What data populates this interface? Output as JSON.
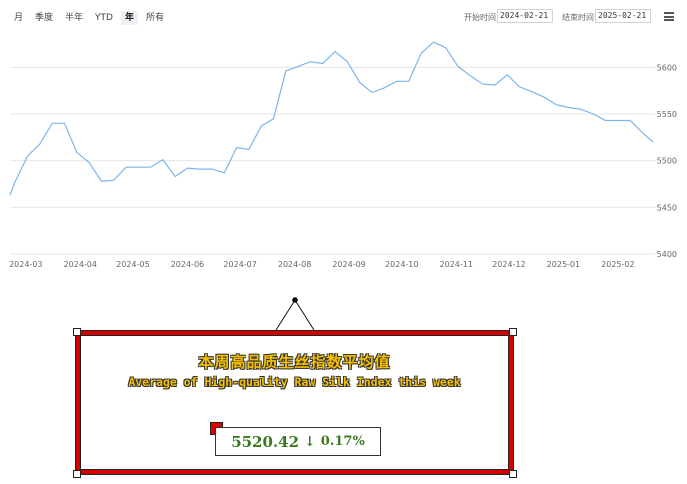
{
  "toolbar": {
    "tabs": [
      "月",
      "季度",
      "半年",
      "YTD",
      "年",
      "所有"
    ],
    "active_tab": "年",
    "start_label": "开始时间",
    "start_value": "2024-02-21",
    "end_label": "结束时间",
    "end_value": "2025-02-21"
  },
  "chart_data": {
    "type": "line",
    "x_ticks": [
      "2024-03",
      "2024-04",
      "2024-05",
      "2024-06",
      "2024-07",
      "2024-08",
      "2024-09",
      "2024-10",
      "2024-11",
      "2024-12",
      "2025-01",
      "2025-02"
    ],
    "y_ticks": [
      5400,
      5450,
      5500,
      5550,
      5600
    ],
    "ylim": [
      5400,
      5640
    ],
    "grid": true,
    "line_color": "#7cb5ec",
    "series": [
      {
        "values": [
          [
            "2024-02-21",
            5463
          ],
          [
            "2024-02-24",
            5478
          ],
          [
            "2024-03-02",
            5505
          ],
          [
            "2024-03-09",
            5518
          ],
          [
            "2024-03-16",
            5540
          ],
          [
            "2024-03-23",
            5540
          ],
          [
            "2024-03-30",
            5509
          ],
          [
            "2024-04-06",
            5498
          ],
          [
            "2024-04-13",
            5478
          ],
          [
            "2024-04-20",
            5479
          ],
          [
            "2024-04-27",
            5493
          ],
          [
            "2024-05-04",
            5493
          ],
          [
            "2024-05-11",
            5493
          ],
          [
            "2024-05-18",
            5501
          ],
          [
            "2024-05-25",
            5483
          ],
          [
            "2024-06-01",
            5492
          ],
          [
            "2024-06-08",
            5491
          ],
          [
            "2024-06-15",
            5491
          ],
          [
            "2024-06-22",
            5487
          ],
          [
            "2024-06-29",
            5514
          ],
          [
            "2024-07-06",
            5512
          ],
          [
            "2024-07-13",
            5537
          ],
          [
            "2024-07-20",
            5545
          ],
          [
            "2024-07-27",
            5596
          ],
          [
            "2024-08-03",
            5601
          ],
          [
            "2024-08-10",
            5606
          ],
          [
            "2024-08-17",
            5604
          ],
          [
            "2024-08-24",
            5617
          ],
          [
            "2024-08-31",
            5606
          ],
          [
            "2024-09-07",
            5584
          ],
          [
            "2024-09-14",
            5573
          ],
          [
            "2024-09-21",
            5578
          ],
          [
            "2024-09-28",
            5585
          ],
          [
            "2024-10-05",
            5585
          ],
          [
            "2024-10-12",
            5615
          ],
          [
            "2024-10-19",
            5627
          ],
          [
            "2024-10-26",
            5621
          ],
          [
            "2024-11-02",
            5601
          ],
          [
            "2024-11-09",
            5591
          ],
          [
            "2024-11-16",
            5582
          ],
          [
            "2024-11-23",
            5581
          ],
          [
            "2024-11-30",
            5592
          ],
          [
            "2024-12-07",
            5579
          ],
          [
            "2024-12-14",
            5574
          ],
          [
            "2024-12-21",
            5568
          ],
          [
            "2024-12-28",
            5560
          ],
          [
            "2025-01-04",
            5557
          ],
          [
            "2025-01-11",
            5555
          ],
          [
            "2025-01-18",
            5550
          ],
          [
            "2025-01-25",
            5543
          ],
          [
            "2025-02-01",
            5543
          ],
          [
            "2025-02-08",
            5543
          ],
          [
            "2025-02-15",
            5530
          ],
          [
            "2025-02-21",
            5520
          ]
        ]
      }
    ]
  },
  "panel": {
    "title_cn": "本周高品质生丝指数平均值",
    "title_en": "Average of High-quality Raw Silk Index this week",
    "value": "5520.42",
    "arrow": "↓",
    "change": "0.17%",
    "accent_color": "#d40000",
    "value_color": "#3a7a1e",
    "title_color": "#f5c000"
  }
}
